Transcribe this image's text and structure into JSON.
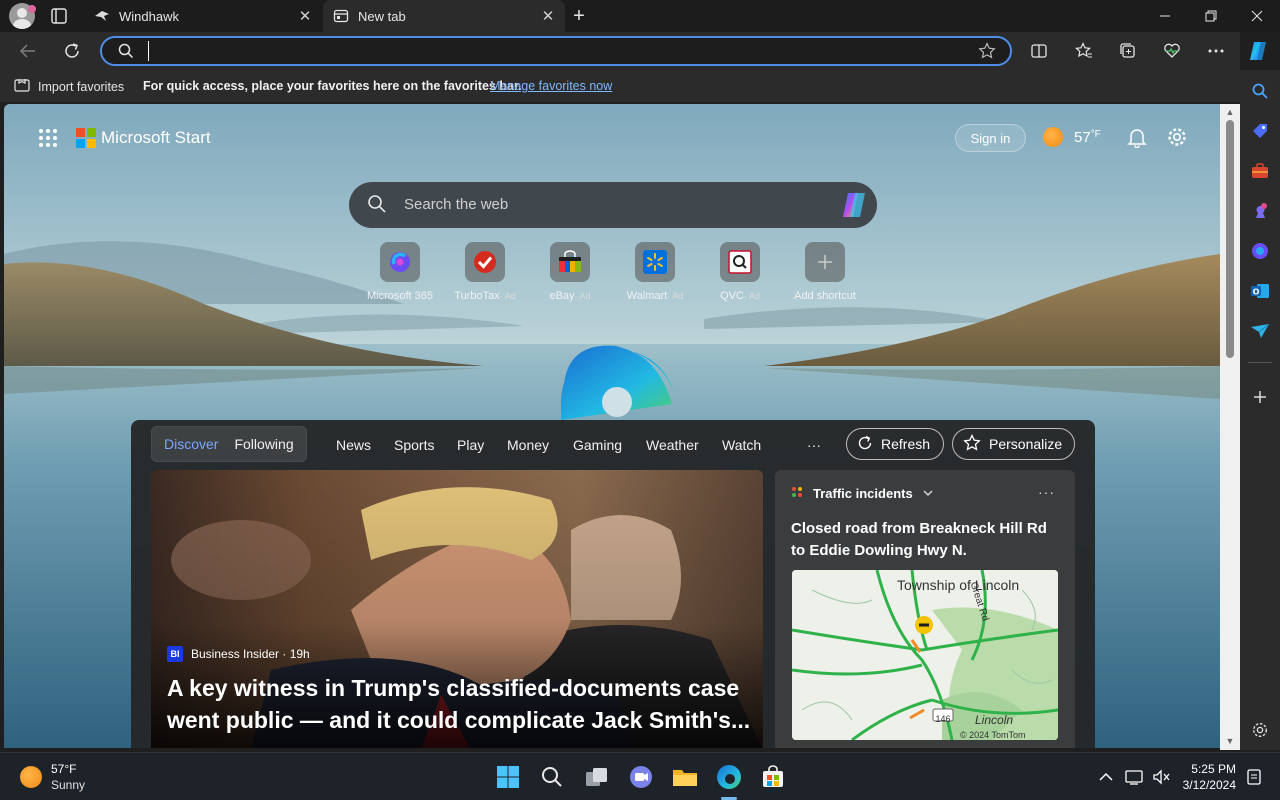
{
  "browser": {
    "tabs": [
      {
        "title": "Windhawk"
      },
      {
        "title": "New tab"
      }
    ],
    "address": {
      "value": "",
      "placeholder": ""
    },
    "favorites_bar": {
      "import_label": "Import favorites",
      "message": "For quick access, place your favorites here on the favorites bar.",
      "link": "Manage favorites now"
    }
  },
  "start": {
    "brand": "Microsoft Start",
    "sign_in": "Sign in",
    "weather_temp": "57",
    "weather_unit": "°F",
    "search_placeholder": "Search the web",
    "quick_links": [
      {
        "label": "Microsoft 365",
        "ad": ""
      },
      {
        "label": "TurboTax",
        "ad": "· Ad"
      },
      {
        "label": "eBay",
        "ad": "· Ad"
      },
      {
        "label": "Walmart",
        "ad": "· Ad"
      },
      {
        "label": "QVC",
        "ad": "· Ad"
      },
      {
        "label": "Add shortcut",
        "ad": ""
      }
    ]
  },
  "feed": {
    "segments": [
      "Discover",
      "Following"
    ],
    "active_segment": "Discover",
    "tabs": [
      "News",
      "Sports",
      "Play",
      "Money",
      "Gaming",
      "Weather",
      "Watch"
    ],
    "more": "···",
    "refresh": "Refresh",
    "personalize": "Personalize",
    "hero": {
      "source": "Business Insider · 19h",
      "source_badge": "BI",
      "title": "A key witness in Trump's classified-documents case went public — and it could complicate Jack Smith's..."
    },
    "traffic": {
      "header": "Traffic incidents",
      "title": "Closed road from Breakneck Hill Rd to Eddie Dowling Hwy N.",
      "map": {
        "place1": "Township of Lincoln",
        "road": "Great Rd",
        "place2": "Lincoln",
        "route": "146",
        "copyright": "© 2024 TomTom"
      }
    }
  },
  "taskbar": {
    "weather_temp": "57°F",
    "weather_cond": "Sunny",
    "time": "5:25 PM",
    "date": "3/12/2024"
  },
  "colors": {
    "accent": "#4f8ee8",
    "link": "#7fb7ff",
    "active_tab_text": "#79a6ff"
  }
}
